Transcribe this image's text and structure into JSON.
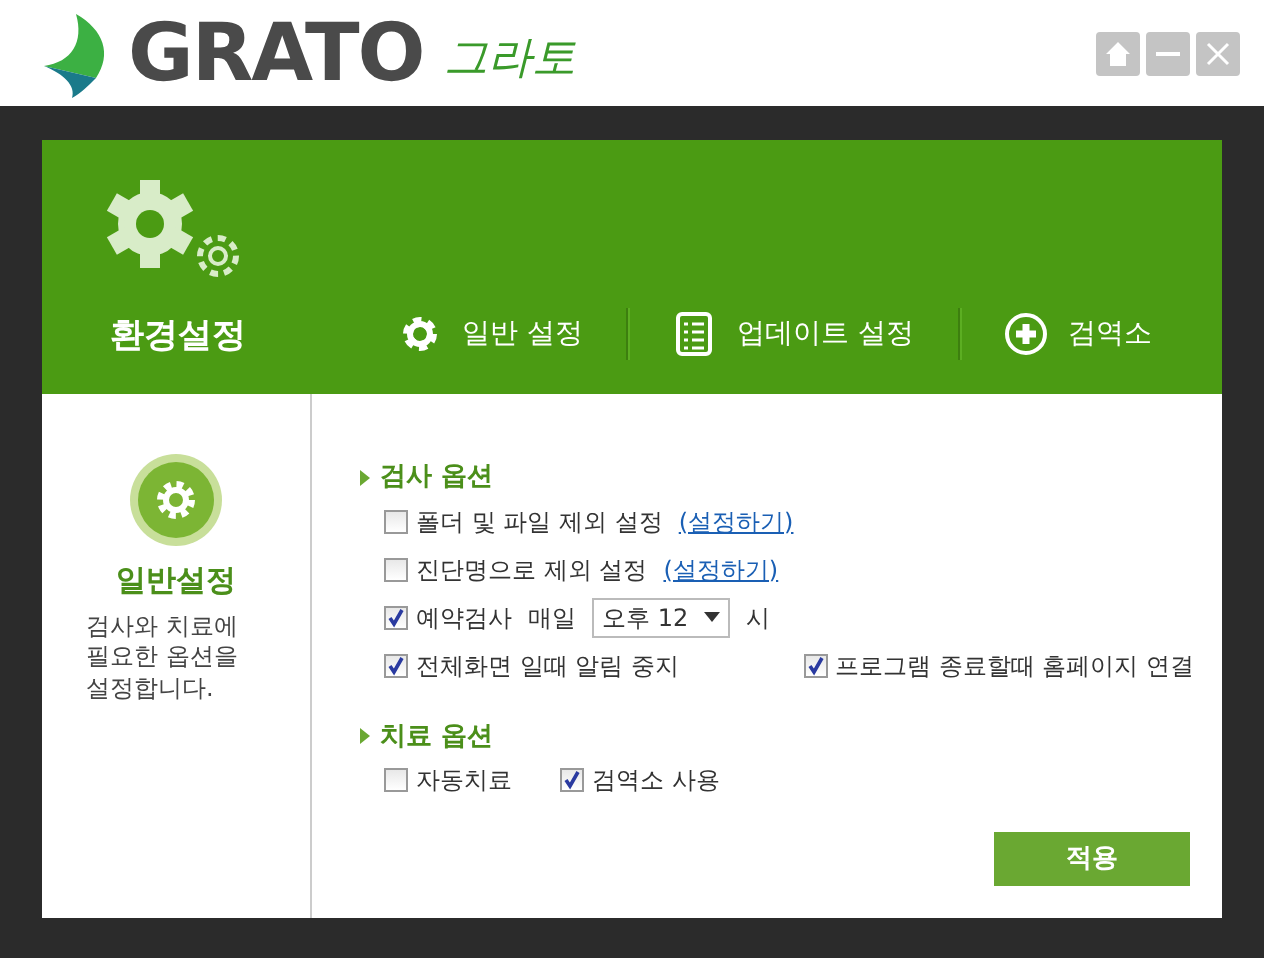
{
  "titlebar": {
    "logo": "GRATO",
    "logo_sub": "그라토",
    "buttons": [
      {
        "kind": "home"
      },
      {
        "kind": "minimize"
      },
      {
        "kind": "close"
      }
    ]
  },
  "header": {
    "title": "환경설정",
    "tabs": [
      {
        "label": "일반 설정"
      },
      {
        "label": "업데이트 설정"
      },
      {
        "label": "검역소"
      }
    ]
  },
  "sidebar": {
    "title": "일반설정",
    "description": "검사와 치료에 필요한 옵션을 설정합니다."
  },
  "sections": [
    {
      "title": "검사 옵션",
      "rows": [
        {
          "items": [
            {
              "kind": "checkbox",
              "label": "폴더 및 파일 제외 설정",
              "checked": false
            },
            {
              "kind": "link",
              "label": "(설정하기)"
            }
          ]
        },
        {
          "items": [
            {
              "kind": "checkbox",
              "label": "진단명으로 제외 설정",
              "checked": false
            },
            {
              "kind": "link",
              "label": "(설정하기)"
            }
          ]
        },
        {
          "items": [
            {
              "kind": "checkbox",
              "label": "예약검사",
              "checked": true
            },
            {
              "kind": "text",
              "label": "매일"
            },
            {
              "kind": "select",
              "value": "오후 12"
            },
            {
              "kind": "text",
              "label": "시"
            }
          ]
        },
        {
          "items": [
            {
              "kind": "checkbox",
              "label": "전체화면 일때 알림 중지",
              "checked": true
            },
            {
              "kind": "checkbox",
              "label": "프로그램 종료할때 홈페이지 연결",
              "checked": true
            }
          ]
        }
      ]
    },
    {
      "title": "치료 옵션",
      "rows": [
        {
          "items": [
            {
              "kind": "checkbox",
              "label": "자동치료",
              "checked": false
            },
            {
              "kind": "checkbox",
              "label": "검역소 사용",
              "checked": true
            }
          ]
        }
      ]
    }
  ],
  "apply_button": "적용"
}
